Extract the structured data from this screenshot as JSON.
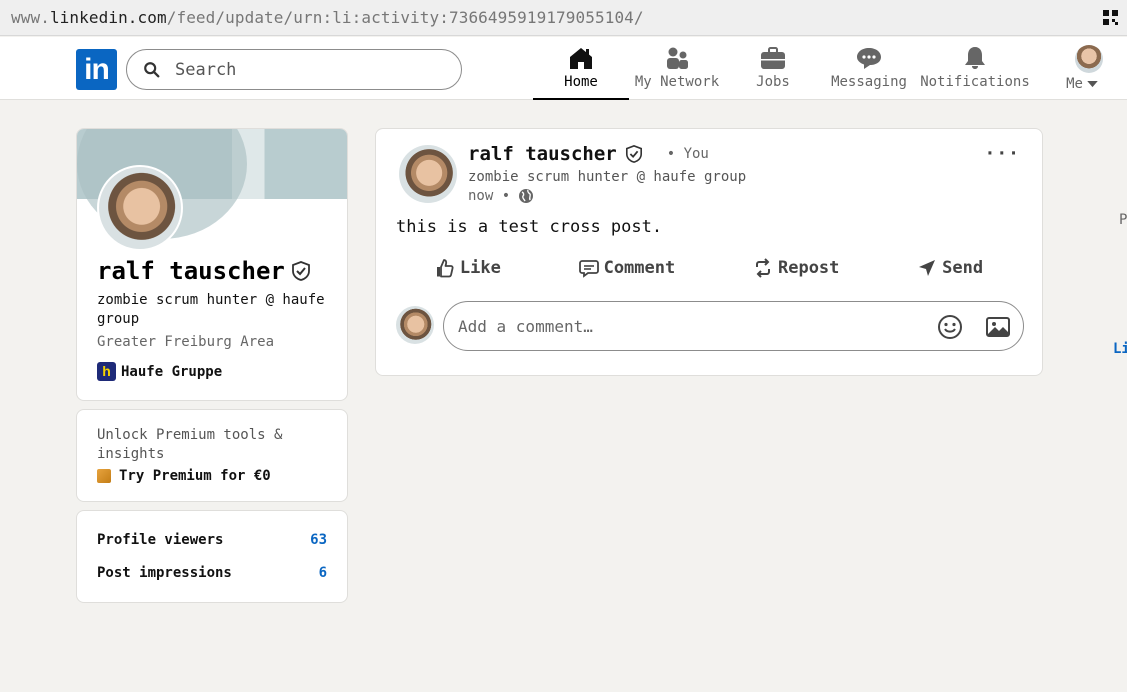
{
  "browser": {
    "url_prefix": "www.",
    "url_host": "linkedin.com",
    "url_path": "/feed/update/urn:li:activity:7366495919179055104/"
  },
  "nav": {
    "logo": "in",
    "search_placeholder": "Search",
    "items": [
      {
        "label": "Home",
        "icon": "home-icon",
        "active": true
      },
      {
        "label": "My Network",
        "icon": "network-icon"
      },
      {
        "label": "Jobs",
        "icon": "briefcase-icon"
      },
      {
        "label": "Messaging",
        "icon": "messaging-icon"
      },
      {
        "label": "Notifications",
        "icon": "bell-icon"
      },
      {
        "label": "Me",
        "icon": "avatar"
      }
    ]
  },
  "profile": {
    "name": "ralf tauscher",
    "headline": "zombie scrum hunter @ haufe group",
    "location": "Greater Freiburg Area",
    "company": "Haufe Gruppe",
    "company_logo_letter": "h"
  },
  "premium": {
    "text": "Unlock Premium tools & insights",
    "link": "Try Premium for €0"
  },
  "stats": [
    {
      "label": "Profile viewers",
      "value": "63"
    },
    {
      "label": "Post impressions",
      "value": "6"
    }
  ],
  "post": {
    "author": "ralf tauscher",
    "you_label": "• You",
    "headline": "zombie scrum hunter @ haufe group",
    "time": "now •",
    "more": "···",
    "body": "this is a test cross post.",
    "actions": [
      {
        "label": "Like",
        "icon": "like-icon"
      },
      {
        "label": "Comment",
        "icon": "comment-icon"
      },
      {
        "label": "Repost",
        "icon": "repost-icon"
      },
      {
        "label": "Send",
        "icon": "send-icon"
      }
    ],
    "comment_placeholder": "Add a comment…"
  },
  "edge": {
    "p": "P",
    "li": "Li"
  },
  "colors": {
    "brand": "#0a66c2",
    "background": "#f3f2ef"
  }
}
